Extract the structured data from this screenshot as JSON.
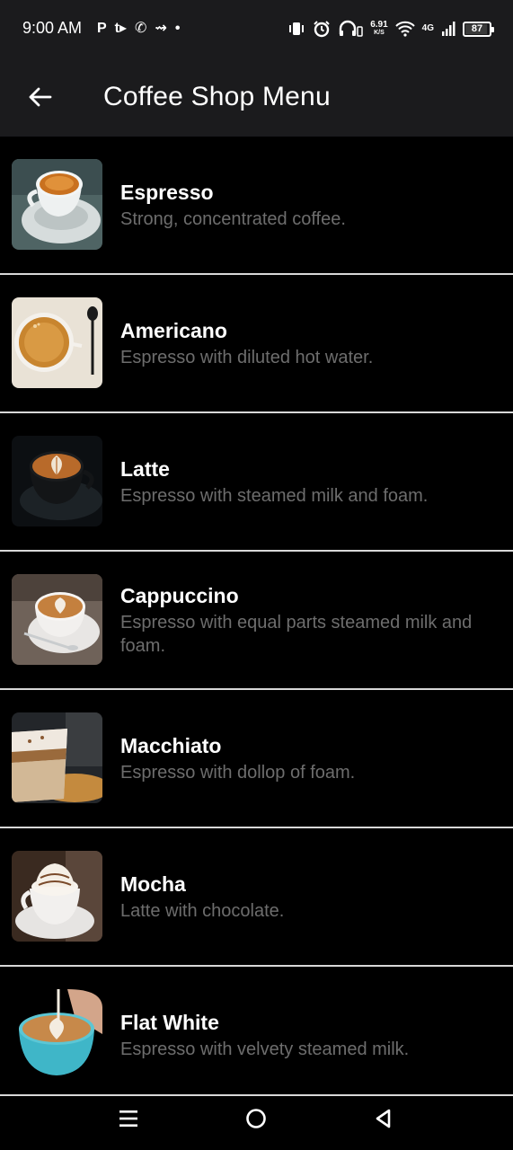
{
  "status_bar": {
    "time": "9:00 AM",
    "left_icons": [
      "P",
      "t▸",
      "✆",
      "⇝",
      "•"
    ],
    "speed_value": "6.91",
    "speed_unit": "K/S",
    "network": "4G",
    "battery": "87"
  },
  "app_bar": {
    "title": "Coffee Shop Menu",
    "back_icon": "arrow-left-icon"
  },
  "menu": [
    {
      "name": "Espresso",
      "desc": "Strong, concentrated coffee."
    },
    {
      "name": "Americano",
      "desc": "Espresso with diluted hot water."
    },
    {
      "name": "Latte",
      "desc": "Espresso with steamed milk and foam."
    },
    {
      "name": "Cappuccino",
      "desc": "Espresso with equal parts steamed milk and foam."
    },
    {
      "name": "Macchiato",
      "desc": "Espresso with dollop of foam."
    },
    {
      "name": "Mocha",
      "desc": "Latte with chocolate."
    },
    {
      "name": "Flat White",
      "desc": "Espresso with velvety steamed milk."
    }
  ],
  "nav_bar": {
    "icons": [
      "menu-icon",
      "home-circle-icon",
      "back-triangle-icon"
    ]
  },
  "colors": {
    "bar_bg": "#1b1b1d",
    "list_bg": "#000000",
    "divider": "#d8d8d8",
    "desc_text": "#6d6d6d"
  }
}
